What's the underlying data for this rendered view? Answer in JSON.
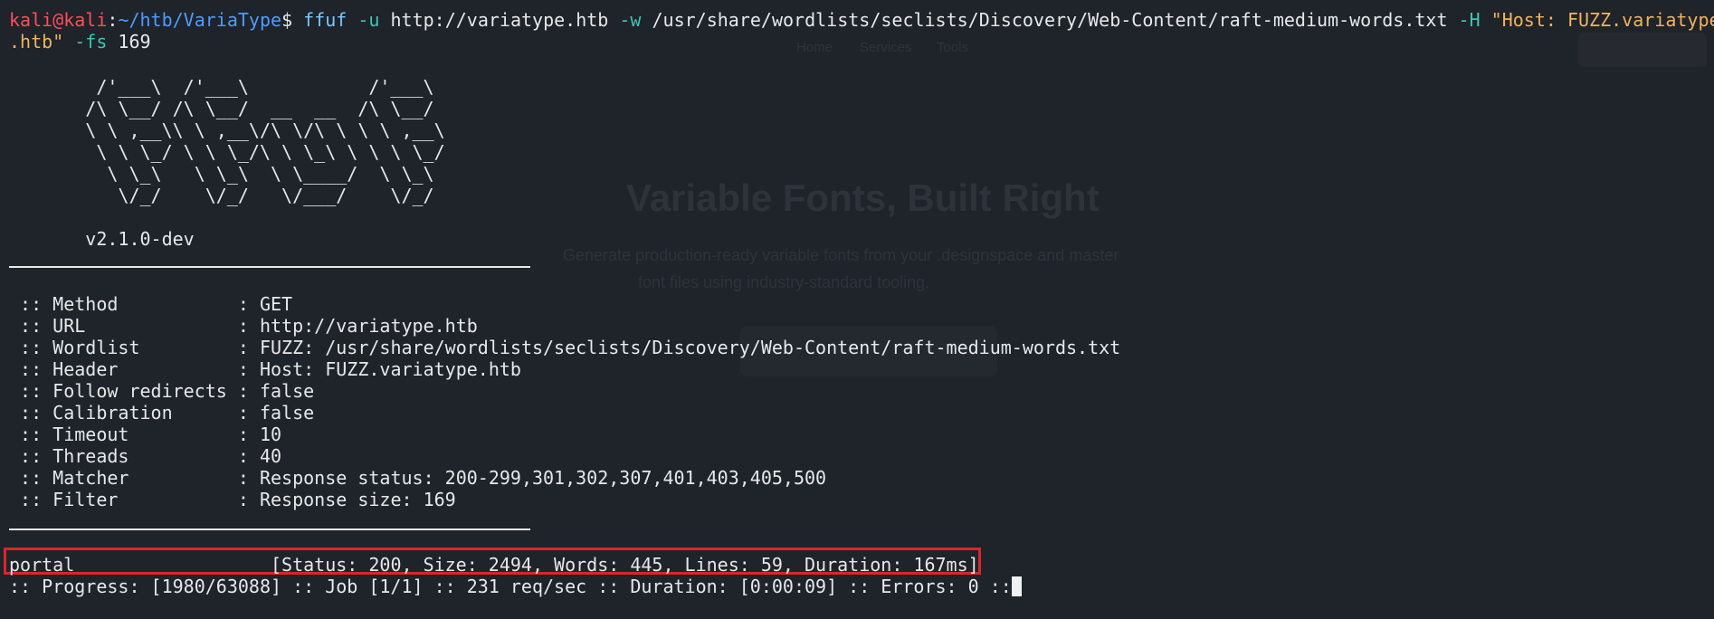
{
  "prompt": {
    "user": "kali",
    "at": "@",
    "host": "kali",
    "colon": ":",
    "path": "~/htb/VariaType",
    "symbol": "$ "
  },
  "command": {
    "program": "ffuf",
    "flag_u": " -u",
    "url": " http://variatype.htb",
    "flag_w": " -w",
    "wordlist": " /usr/share/wordlists/seclists/Discovery/Web-Content/raft-medium-words.txt",
    "flag_h": " -H",
    "header_start": " \"Host: FUZZ.variatype",
    "header_end": ".htb\"",
    "flag_fs": " -fs",
    "fs_value": " 169"
  },
  "banner": [
    "        /'___\\  /'___\\           /'___\\       ",
    "       /\\ \\__/ /\\ \\__/  __  __  /\\ \\__/       ",
    "       \\ \\ ,__\\\\ \\ ,__\\/\\ \\/\\ \\ \\ \\ ,__\\      ",
    "        \\ \\ \\_/ \\ \\ \\_/\\ \\ \\_\\ \\ \\ \\ \\_/      ",
    "         \\ \\_\\   \\ \\_\\  \\ \\____/  \\ \\_\\       ",
    "          \\/_/    \\/_/   \\/___/    \\/_/       "
  ],
  "version": "       v2.1.0-dev",
  "config": [
    {
      "key": " :: Method           : ",
      "value": "GET"
    },
    {
      "key": " :: URL              : ",
      "value": "http://variatype.htb"
    },
    {
      "key": " :: Wordlist         : ",
      "value": "FUZZ: /usr/share/wordlists/seclists/Discovery/Web-Content/raft-medium-words.txt"
    },
    {
      "key": " :: Header           : ",
      "value": "Host: FUZZ.variatype.htb"
    },
    {
      "key": " :: Follow redirects : ",
      "value": "false"
    },
    {
      "key": " :: Calibration      : ",
      "value": "false"
    },
    {
      "key": " :: Timeout          : ",
      "value": "10"
    },
    {
      "key": " :: Threads          : ",
      "value": "40"
    },
    {
      "key": " :: Matcher          : ",
      "value": "Response status: 200-299,301,302,307,401,403,405,500"
    },
    {
      "key": " :: Filter           : ",
      "value": "Response size: 169"
    }
  ],
  "result": {
    "word": "portal",
    "details": "                  [Status: 200, Size: 2494, Words: 445, Lines: 59, Duration: 167ms]"
  },
  "progress": ":: Progress: [1980/63088] :: Job [1/1] :: 231 req/sec :: Duration: [0:00:09] :: Errors: 0 ::",
  "ghost": {
    "title": "Variable Fonts, Built Right",
    "sub1": "Generate production-ready variable fonts from your .designspace and master",
    "sub2": "font files using industry-standard tooling.",
    "nav": [
      "Home",
      "Services",
      "Tools"
    ],
    "ghost_left": "ariable",
    "cta": "Get Started"
  },
  "colors": {
    "background": "#1f232a",
    "prompt_red": "#ff4d5a",
    "path_blue": "#4d9cff",
    "flag_teal": "#3ec7b3",
    "string_orange": "#f0b35e",
    "highlight_red": "#d9262a"
  }
}
